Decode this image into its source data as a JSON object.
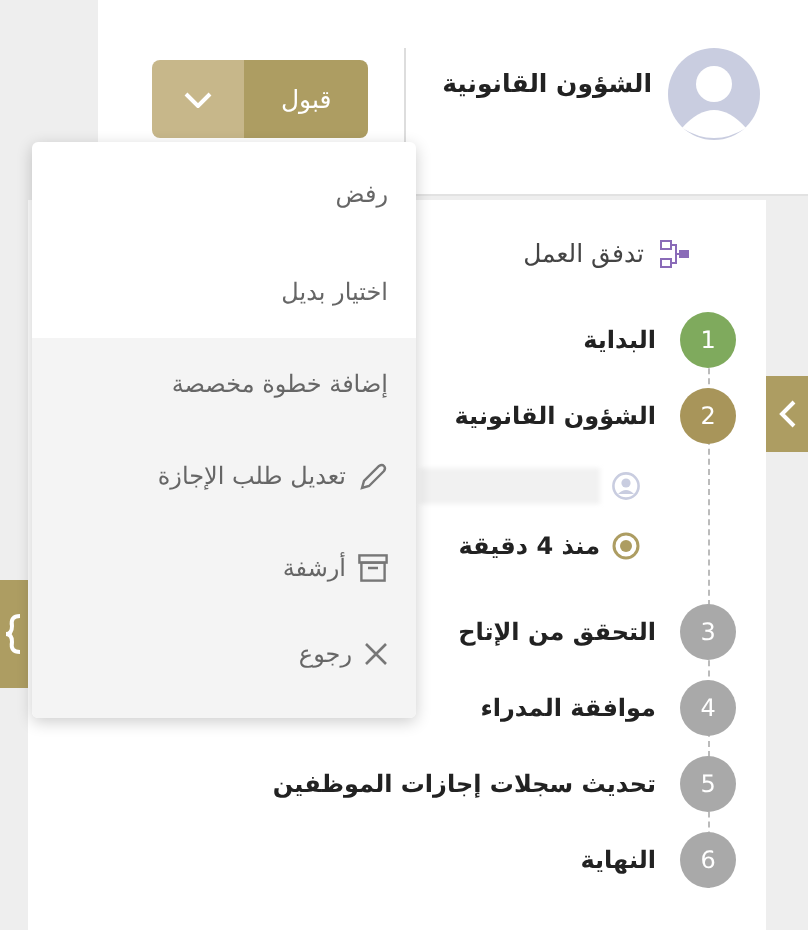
{
  "header": {
    "user_name": "الشؤون القانونية",
    "action_button": {
      "label": "قبول"
    }
  },
  "menu": {
    "sections": [
      {
        "shaded": false,
        "items": [
          {
            "label": "رفض",
            "kind": "plain"
          },
          {
            "label": "اختيار بديل",
            "kind": "plain"
          }
        ]
      },
      {
        "shaded": true,
        "items": [
          {
            "label": "إضافة خطوة مخصصة",
            "kind": "plain"
          },
          {
            "label": "تعديل طلب الإجازة",
            "kind": "edit"
          },
          {
            "label": "أرشفة",
            "kind": "archive"
          },
          {
            "label": "رجوع",
            "kind": "back"
          }
        ]
      }
    ]
  },
  "workflow": {
    "title": "تدفق العمل",
    "steps": [
      {
        "number": "1",
        "label": "البداية",
        "kind": "done"
      },
      {
        "number": "2",
        "label": "الشؤون القانونية",
        "kind": "current",
        "detail": {
          "time": "منذ 4 دقيقة"
        }
      },
      {
        "number": "3",
        "label": "التحقق من الإتاح",
        "kind": "pending"
      },
      {
        "number": "4",
        "label": "موافقة المدراء",
        "kind": "pending"
      },
      {
        "number": "5",
        "label": "تحديث سجلات إجازات الموظفين",
        "kind": "pending"
      },
      {
        "number": "6",
        "label": "النهاية",
        "kind": "pending"
      }
    ]
  }
}
